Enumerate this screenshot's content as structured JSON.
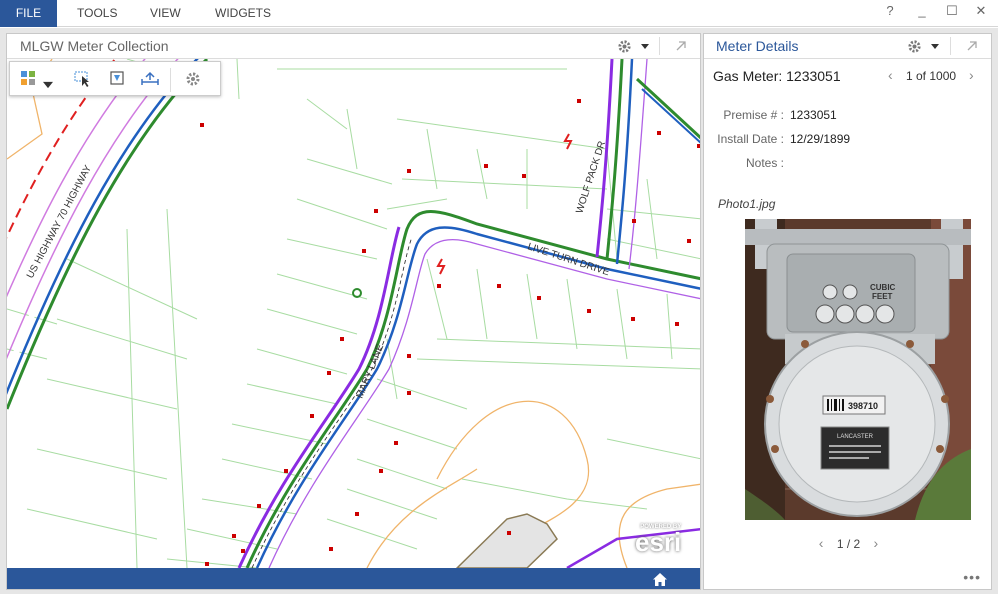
{
  "menu": {
    "file": "FILE",
    "tools": "TOOLS",
    "view": "VIEW",
    "widgets": "WIDGETS"
  },
  "window_controls": {
    "help": "?",
    "minimize": "_",
    "maximize": "☐",
    "close": "✕"
  },
  "map_panel": {
    "title": "MLGW Meter Collection",
    "street_labels": [
      "US HIGHWAY 70 HIGHWAY",
      "WOLF PACK DR",
      "LIVE TURN DRIVE",
      "MARY LANE"
    ]
  },
  "detail_panel": {
    "title": "Meter Details",
    "feature_title": "Gas Meter: 1233051",
    "pager": "1 of 1000",
    "attributes": [
      {
        "label": "Premise # :",
        "value": "1233051"
      },
      {
        "label": "Install Date :",
        "value": "12/29/1899"
      },
      {
        "label": "Notes :",
        "value": ""
      }
    ],
    "photo": {
      "name": "Photo1.jpg",
      "pager": "1 / 2",
      "meter_text": {
        "cubic": "CUBIC",
        "feet": "FEET",
        "serial": "398710",
        "maker": "LANCASTER"
      }
    }
  },
  "esri": {
    "powered_by": "POWERED BY",
    "logo": "esri"
  },
  "colors": {
    "accent": "#2b579a",
    "parcel": "#9fd49a",
    "road_purple": "#8a2be2",
    "road_blue": "#1f5fbf",
    "road_green": "#2e8b2e",
    "meter_red": "#cc0000"
  }
}
